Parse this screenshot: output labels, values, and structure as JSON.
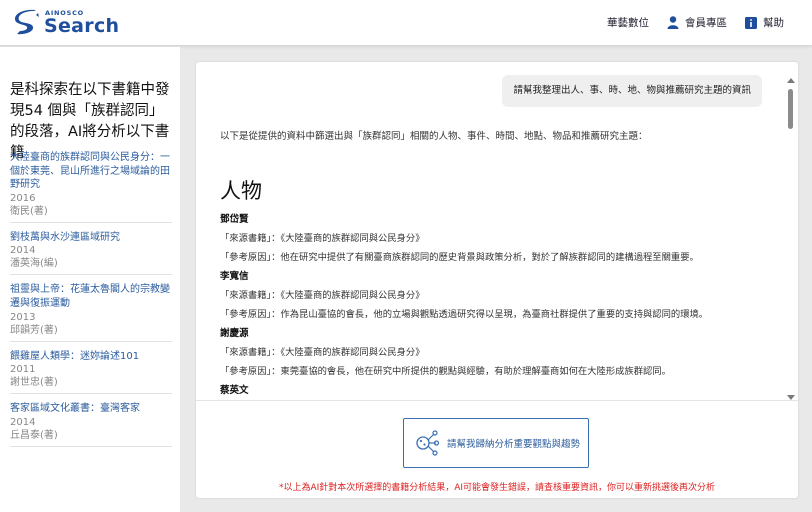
{
  "header": {
    "logo_small": "AINOSCO",
    "logo_big": "Search",
    "nav": [
      {
        "label": "華藝數位",
        "icon": ""
      },
      {
        "label": "會員專區",
        "icon": "user-icon"
      },
      {
        "label": "幫助",
        "icon": "info-icon"
      }
    ],
    "colors": {
      "brand": "#1e4e9c",
      "link": "#2c5d9e",
      "warning": "#dd2222"
    }
  },
  "sidebar": {
    "title": "是科探索在以下書籍中發現54 個與「族群認同」的段落，AI將分析以下書籍",
    "books": [
      {
        "title": "大陸臺商的族群認同與公民身分：一個於東莞、昆山所進行之場域論的田野研究",
        "year": "2016",
        "author": "衛民(著)"
      },
      {
        "title": "劉枝萬與水沙連區域研究",
        "year": "2014",
        "author": "潘英海(編)"
      },
      {
        "title": "祖靈與上帝：花蓮太魯閣人的宗教變遷與復振運動",
        "year": "2013",
        "author": "邱韻芳(著)"
      },
      {
        "title": "餵雞屋人類學：迷妳論述101",
        "year": "2011",
        "author": "謝世忠(著)"
      },
      {
        "title": "客家區域文化叢書：臺灣客家",
        "year": "2014",
        "author": "丘昌泰(著)"
      }
    ]
  },
  "main": {
    "user_query": "請幫我整理出人、事、時、地、物與推薦研究主題的資訊",
    "intro": "以下是從提供的資料中篩選出與「族群認同」相關的人物、事件、時間、地點、物品和推薦研究主題：",
    "section_heading": "人物",
    "people": [
      {
        "name": "鄧岱賢",
        "source": "「來源書籍」：《大陸臺商的族群認同與公民身分》",
        "reason": "「參考原因」：他在研究中提供了有關臺商族群認同的歷史背景與政策分析，對於了解族群認同的建構過程至關重要。"
      },
      {
        "name": "李寬信",
        "source": "「來源書籍」：《大陸臺商的族群認同與公民身分》",
        "reason": "「參考原因」：作為昆山臺協的會長，他的立場與觀點透過研究得以呈現，為臺商社群提供了重要的支持與認同的環境。"
      },
      {
        "name": "謝慶源",
        "source": "「來源書籍」：《大陸臺商的族群認同與公民身分》",
        "reason": "「參考原因」：東莞臺協的會長，他在研究中所提供的觀點與經驗，有助於理解臺商如何在大陸形成族群認同。"
      },
      {
        "name": "蔡英文",
        "source": "",
        "reason": ""
      }
    ],
    "analyze_button": "請幫我歸納分析重要觀點與趨勢",
    "disclaimer": "*以上為AI針對本次所選擇的書籍分析結果，AI可能會發生錯誤，請查核重要資訊，你可以重新挑選後再次分析"
  }
}
